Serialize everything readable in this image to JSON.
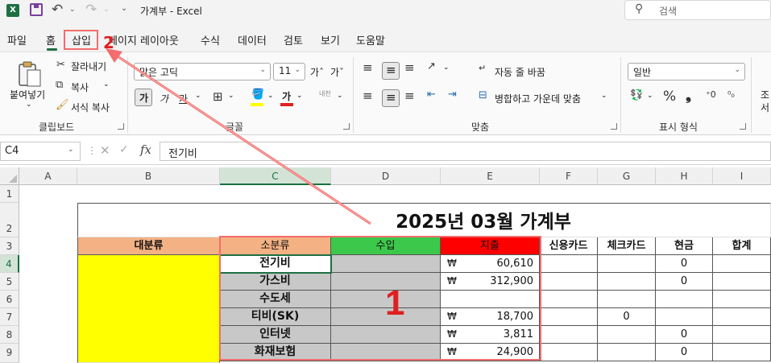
{
  "titlebar": {
    "app_logo": "X",
    "title": "가계부  -  Excel",
    "search_placeholder": "검색"
  },
  "menu": {
    "tabs": [
      "파일",
      "홈",
      "삽입",
      "페이지 레이아웃",
      "수식",
      "데이터",
      "검토",
      "보기",
      "도움말"
    ],
    "active_tab": "홈"
  },
  "ribbon": {
    "clipboard": {
      "paste": "붙여넣기",
      "cut": "잘라내기",
      "copy": "복사",
      "format_painter": "서식 복사",
      "group_label": "클립보드"
    },
    "font": {
      "font_name": "맑은 고딕",
      "font_size": "11",
      "grow": "가ˆ",
      "shrink": "가ˇ",
      "bold": "가",
      "italic": "가",
      "underline": "가",
      "font_color_glyph": "가",
      "phonetic": "내천",
      "group_label": "글꼴"
    },
    "alignment": {
      "wrap_text": "자동 줄 바꿈",
      "merge_center": "병합하고 가운데 맞춤",
      "group_label": "맞춤"
    },
    "number": {
      "format": "일반",
      "percent": "%",
      "comma": "❟",
      "group_label": "표시 형식"
    },
    "cut_off": [
      "조",
      "서"
    ]
  },
  "formula_bar": {
    "name_box": "C4",
    "fx": "fx",
    "content": "전기비"
  },
  "sheet": {
    "columns": [
      "A",
      "B",
      "C",
      "D",
      "E",
      "F",
      "G",
      "H",
      "I"
    ],
    "selected_column": "C",
    "rows": [
      "1",
      "2",
      "3",
      "4",
      "5",
      "6",
      "7",
      "8",
      "9"
    ],
    "selected_row": "4",
    "title": "2025년 03월 가계부",
    "headers": {
      "major": "대분류",
      "minor": "소분류",
      "income": "수입",
      "expense": "지출",
      "credit": "신용카드",
      "check": "체크카드",
      "cash": "현금",
      "total": "합계"
    },
    "currency": "₩",
    "data_rows": [
      {
        "minor": "전기비",
        "expense": "60,610",
        "check": "",
        "cash": "0"
      },
      {
        "minor": "가스비",
        "expense": "312,900",
        "check": "",
        "cash": "0"
      },
      {
        "minor": "수도세",
        "expense": "",
        "check": "",
        "cash": ""
      },
      {
        "minor": "티비(SK)",
        "expense": "18,700",
        "check": "0",
        "cash": ""
      },
      {
        "minor": "인터넷",
        "expense": "3,811",
        "check": "",
        "cash": "0"
      },
      {
        "minor": "화재보험",
        "expense": "24,900",
        "check": "",
        "cash": "0"
      }
    ],
    "colors": {
      "major_fill": "#ffff00",
      "header_salmon": "#f4b183",
      "income_green": "#3cc84a",
      "expense_red": "#ff0000",
      "gray": "#c8c8c8",
      "excel_green": "#1d6f42"
    }
  },
  "annotations": {
    "label_1": "1",
    "label_2": "2",
    "color": "#f26d6d"
  }
}
